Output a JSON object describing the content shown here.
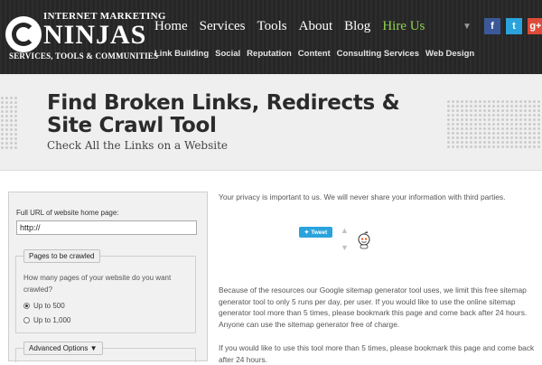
{
  "logo": {
    "top": "INTERNET MARKETING",
    "main": "NINJAS",
    "sub": "SERVICES, TOOLS & COMMUNITIES"
  },
  "nav": {
    "main": [
      "Home",
      "Services",
      "Tools",
      "About",
      "Blog",
      "Hire Us"
    ],
    "sub": [
      "Link Building",
      "Social",
      "Reputation",
      "Content",
      "Consulting Services",
      "Web Design"
    ]
  },
  "social": {
    "facebook": "f",
    "twitter": "t",
    "googleplus": "g+",
    "colors": {
      "facebook": "#3b5998",
      "twitter": "#2aa3dd",
      "googleplus": "#dd4b39"
    }
  },
  "hero": {
    "title": "Find Broken Links, Redirects & Site Crawl Tool",
    "subtitle": "Check All the Links on a Website"
  },
  "form": {
    "url_label": "Full URL of website home page:",
    "url_value": "http://",
    "pages_legend": "Pages to be crawled",
    "pages_question": "How many pages of your website do you want crawled?",
    "option_500": "Up to 500",
    "option_1000": "Up to 1,000",
    "advanced_label": "Advanced Options"
  },
  "content": {
    "privacy": "Your privacy is important to us. We will never share your information with third parties.",
    "tweet": "Tweet",
    "limit": "Because of the resources our Google sitemap generator tool uses, we limit this free sitemap generator tool to only 5 runs per day, per user. If you would like to use the online sitemap generator tool more than 5 times, please bookmark this page and come back after 24 hours. Anyone can use the sitemap generator free of charge.",
    "bookmark": "If you would like to use this tool more than 5 times, please bookmark this page and come back after 24 hours."
  },
  "icons": {
    "upvote": "arrow-up-icon",
    "downvote": "arrow-down-icon",
    "reddit": "reddit-alien-icon",
    "menu": "chevron-down-icon"
  }
}
